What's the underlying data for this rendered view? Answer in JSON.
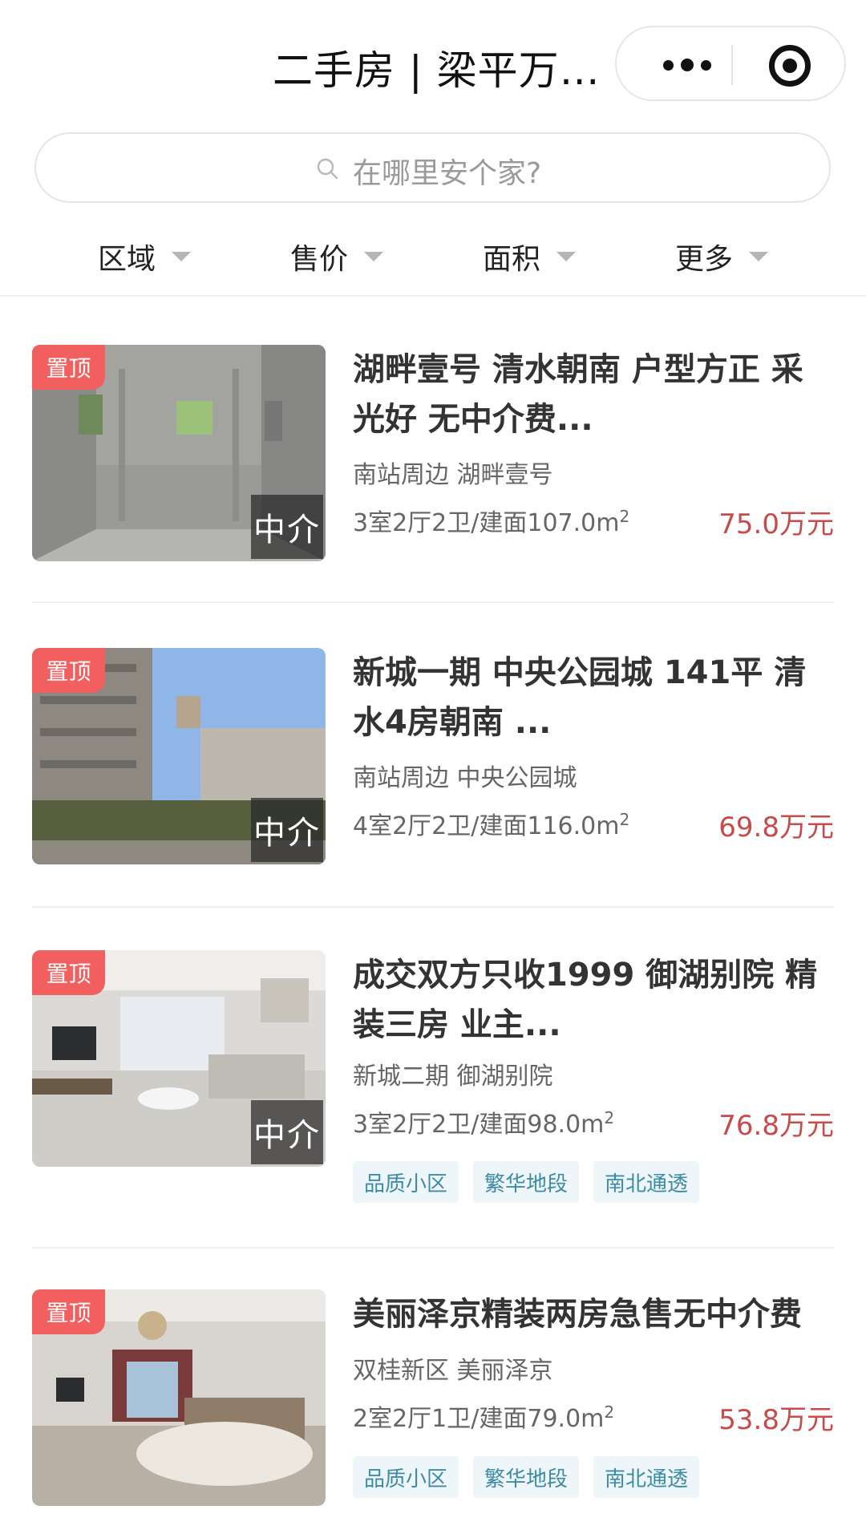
{
  "header": {
    "title": "二手房 | 梁平万…"
  },
  "search": {
    "placeholder": "在哪里安个家?"
  },
  "filters": [
    {
      "label": "区域"
    },
    {
      "label": "售价"
    },
    {
      "label": "面积"
    },
    {
      "label": "更多"
    }
  ],
  "listings": [
    {
      "pin": "置顶",
      "agent": "中介",
      "title": "湖畔壹号 清水朝南 户型方正 采光好 无中介费...",
      "location": "南站周边 湖畔壹号",
      "spec": "3室2厅2卫/建面107.0m",
      "spec_sup": "2",
      "price": "75.0万元",
      "tags": []
    },
    {
      "pin": "置顶",
      "agent": "中介",
      "title": "新城一期 中央公园城 141平 清水4房朝南 ...",
      "location": "南站周边 中央公园城",
      "spec": "4室2厅2卫/建面116.0m",
      "spec_sup": "2",
      "price": "69.8万元",
      "tags": []
    },
    {
      "pin": "置顶",
      "agent": "中介",
      "title": "成交双方只收1999 御湖别院 精装三房 业主...",
      "location": "新城二期 御湖别院",
      "spec": "3室2厅2卫/建面98.0m",
      "spec_sup": "2",
      "price": "76.8万元",
      "tags": [
        "品质小区",
        "繁华地段",
        "南北通透"
      ]
    },
    {
      "pin": "置顶",
      "agent": "",
      "title": "美丽泽京精装两房急售无中介费",
      "location": "双桂新区 美丽泽京",
      "spec": "2室2厅1卫/建面79.0m",
      "spec_sup": "2",
      "price": "53.8万元",
      "tags": [
        "品质小区",
        "繁华地段",
        "南北通透"
      ]
    }
  ]
}
